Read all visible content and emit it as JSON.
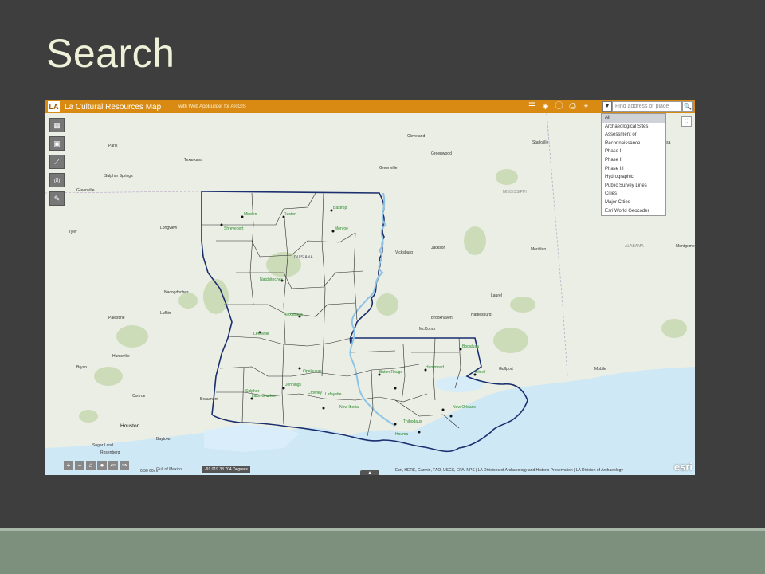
{
  "slide": {
    "title": "Search"
  },
  "app": {
    "logo": "LA",
    "title": "La Cultural Resources Map",
    "subtitle": "with Web AppBuilder for ArcGIS",
    "header_icons": [
      "list-icon",
      "layers-icon",
      "info-icon",
      "print-icon",
      "locate-icon"
    ],
    "search": {
      "placeholder": "Find address or place",
      "dropdown_glyph": "▼",
      "button_glyph": "🔍",
      "options": [
        "All",
        "Archaeological Sites",
        "Assessment or",
        "Reconnaissance",
        "Phase I",
        "Phase II",
        "Phase III",
        "Hydrographic",
        "Public Survey Lines",
        "Cities",
        "Major Cities",
        "Esri World Geocoder"
      ],
      "selected": "All"
    }
  },
  "map": {
    "state_label": "LOUISIANA",
    "labels": {
      "texas_cities": [
        "Texarkana",
        "Tyler",
        "Longview",
        "Nacogdoches",
        "Lufkin",
        "Huntsville",
        "Houston",
        "Beaumont",
        "Bryan",
        "Conroe",
        "Paris",
        "Sulphur Springs",
        "Greenville",
        "Palestine",
        "Baytown",
        "Sugar Land",
        "Rosenberg"
      ],
      "ms_cities": [
        "Cleveland",
        "Greenwood",
        "Jackson",
        "Vicksburg",
        "Meridian",
        "Laurel",
        "Hattiesburg",
        "Brookhaven",
        "McComb",
        "Gulfport",
        "Mobile",
        "Starkville",
        "Tuscaloosa",
        "Greenville",
        "MISSISSIPPI",
        "ALABAMA",
        "Montgomery"
      ],
      "la_places": [
        "Shreveport",
        "Monroe",
        "Bastrop",
        "Ruston",
        "Natchitoches",
        "Alexandria",
        "Lake Charles",
        "Lafayette",
        "Opelousas",
        "Baton Rouge",
        "Hammond",
        "New Orleans",
        "Houma",
        "Thibodaux",
        "New Iberia",
        "Crowley",
        "Bogalusa",
        "Slidell",
        "Minden",
        "Leesville",
        "Jennings",
        "Sulphur"
      ]
    },
    "tool_buttons": [
      "home-icon",
      "grid-icon",
      "measure-icon",
      "camera-icon",
      "draw-icon"
    ],
    "bottom_tools": [
      "+",
      "−",
      "⌂",
      "●",
      "⇐",
      "⇒"
    ],
    "coordinates": "-91.019 33.704 Degrees",
    "scalebar": "0    30    60mi",
    "attribution": "Esri, HERE, Garmin, FAO, USGS, EPA, NPS | LA Divisions of Archaeology and Historic Preservation | LA Division of Archaeology",
    "esri_logo": "esri",
    "fullscreen_glyph": "⛶",
    "gulf_label": "Gulf of Mexico"
  },
  "colors": {
    "header": "#d98a12",
    "parish_line": "#2a2a2a",
    "state_border": "#1b2e6e",
    "land": "#eaeee4",
    "water": "#cfe8f5",
    "forest": "#c9d9b4",
    "label_green": "#2b8a2b"
  }
}
